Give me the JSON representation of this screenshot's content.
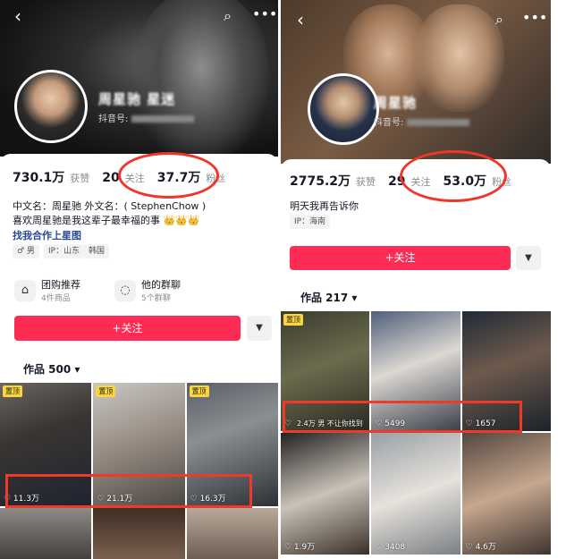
{
  "colors": {
    "brand_red": "#fe2c55",
    "annotation_red": "#f2352b",
    "pin_yellow": "#fbd540"
  },
  "left": {
    "icons": {
      "back": "back-icon",
      "search": "search-icon",
      "more": "more-icon"
    },
    "nickname": "周星驰 星迷",
    "douyin_id_label": "抖音号:",
    "stats": [
      {
        "value": "730.1万",
        "label": "获赞"
      },
      {
        "value": "20",
        "label": "关注"
      },
      {
        "value": "37.7万",
        "label": "粉丝"
      }
    ],
    "bio_lines": [
      "中文名：周星驰 外文名：( StephenChow )",
      "喜欢周星驰是我这辈子最幸福的事 👑👑👑"
    ],
    "bio_link": "找我合作上星图",
    "tags": [
      "♂ 男",
      "IP：山东",
      "韩国"
    ],
    "services": [
      {
        "icon": "shop-icon",
        "title": "团购推荐",
        "sub": "4件商品"
      },
      {
        "icon": "chat-icon",
        "title": "他的群聊",
        "sub": "5个群聊"
      }
    ],
    "follow_label": "+关注",
    "more_label": "▼",
    "works_tab": "作品 500 ▾",
    "videos": [
      {
        "pinned": "置顶",
        "likes": "♡ 11.3万"
      },
      {
        "pinned": "置顶",
        "likes": "♡ 21.1万"
      },
      {
        "pinned": "置顶",
        "likes": "♡ 16.3万"
      },
      {
        "pinned": "",
        "likes": ""
      },
      {
        "pinned": "",
        "likes": ""
      },
      {
        "pinned": "",
        "likes": ""
      }
    ]
  },
  "right": {
    "icons": {
      "back": "back-icon",
      "search": "search-icon",
      "more": "more-icon"
    },
    "nickname": "周星驰",
    "douyin_id_label": "抖音号:",
    "stats": [
      {
        "value": "2775.2万",
        "label": "获赞"
      },
      {
        "value": "29",
        "label": "关注"
      },
      {
        "value": "53.0万",
        "label": "粉丝"
      }
    ],
    "bio_lines": [
      "明天我再告诉你"
    ],
    "tags": [
      "IP：海南"
    ],
    "follow_label": "+关注",
    "more_label": "▼",
    "works_tab": "作品 217 ▾",
    "videos": [
      {
        "pinned": "置顶",
        "likes": "♡",
        "caption": "2.4万 男 不让你找到"
      },
      {
        "pinned": "",
        "likes": "♡ 5499",
        "caption": ""
      },
      {
        "pinned": "",
        "likes": "♡ 1657",
        "caption": ""
      },
      {
        "pinned": "",
        "likes": "♡ 1.9万",
        "caption": ""
      },
      {
        "pinned": "",
        "likes": "♡ 3408",
        "caption": ""
      },
      {
        "pinned": "",
        "likes": "♡ 4.6万",
        "caption": ""
      }
    ]
  }
}
